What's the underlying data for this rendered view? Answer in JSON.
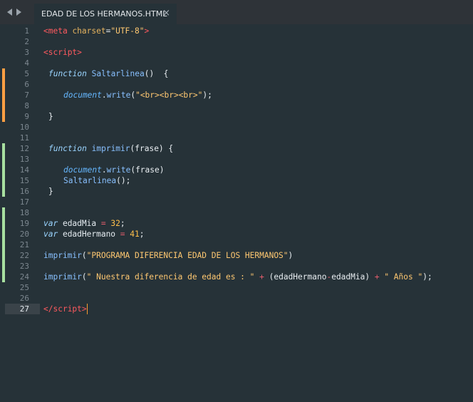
{
  "tab": {
    "title": "EDAD DE LOS HERMANOS.HTML",
    "close": "×"
  },
  "lines": [
    {
      "n": "1"
    },
    {
      "n": "2"
    },
    {
      "n": "3"
    },
    {
      "n": "4"
    },
    {
      "n": "5"
    },
    {
      "n": "6"
    },
    {
      "n": "7"
    },
    {
      "n": "8"
    },
    {
      "n": "9"
    },
    {
      "n": "10"
    },
    {
      "n": "11"
    },
    {
      "n": "12"
    },
    {
      "n": "13"
    },
    {
      "n": "14"
    },
    {
      "n": "15"
    },
    {
      "n": "16"
    },
    {
      "n": "17"
    },
    {
      "n": "18"
    },
    {
      "n": "19"
    },
    {
      "n": "20"
    },
    {
      "n": "21"
    },
    {
      "n": "22"
    },
    {
      "n": "23"
    },
    {
      "n": "24"
    },
    {
      "n": "25"
    },
    {
      "n": "26"
    },
    {
      "n": "27"
    }
  ],
  "code": {
    "l1": {
      "open": "<",
      "tag": "meta",
      "attr": " charset",
      "eq": "=",
      "value": "\"UTF-8\"",
      "close": ">"
    },
    "l3": {
      "open": "<",
      "tag": "script",
      "close": ">"
    },
    "l5": {
      "keyword": "function",
      "name": " Saltarlinea",
      "rest": "()  {"
    },
    "l7": {
      "object": "document",
      "dot": ".",
      "method": "write",
      "open": "(",
      "string": "\"<br><br><br>\"",
      "close": ");"
    },
    "l9": {
      "text": "}"
    },
    "l12": {
      "keyword": "function",
      "name": " imprimir",
      "rest": "(frase) {"
    },
    "l14": {
      "object": "document",
      "dot": ".",
      "method": "write",
      "rest": "(frase)"
    },
    "l15": {
      "call": "Saltarlinea",
      "rest": "();"
    },
    "l16": {
      "text": "}"
    },
    "l19": {
      "keyword": "var",
      "name": " edadMia ",
      "op": "=",
      "num": " 32",
      "end": ";"
    },
    "l20": {
      "keyword": "var",
      "name": " edadHermano ",
      "op": "=",
      "num": " 41",
      "end": ";"
    },
    "l22": {
      "call": "imprimir",
      "open": "(",
      "string": "\"PROGRAMA DIFERENCIA EDAD DE LOS HERMANOS\"",
      "close": ")"
    },
    "l24": {
      "call": "imprimir",
      "open": "(",
      "string": "\" Nuestra diferencia de edad es : \"",
      "sp1": " ",
      "op1": "+",
      "mid": " (edadHermano",
      "op2": "-",
      "mid2": "edadMia) ",
      "op3": "+",
      "sp2": " ",
      "string2": "\" Años \"",
      "close": ");"
    },
    "l27": {
      "open": "</",
      "tag": "script",
      "close": ">"
    }
  },
  "colors": {
    "background": "#263238",
    "tag": "#ff5a5f",
    "keyword": "#9ad4ff",
    "string": "#ffc871",
    "number": "#ffbf4a",
    "modified_marker": "#ff9f43",
    "added_marker": "#a8e0a0"
  }
}
